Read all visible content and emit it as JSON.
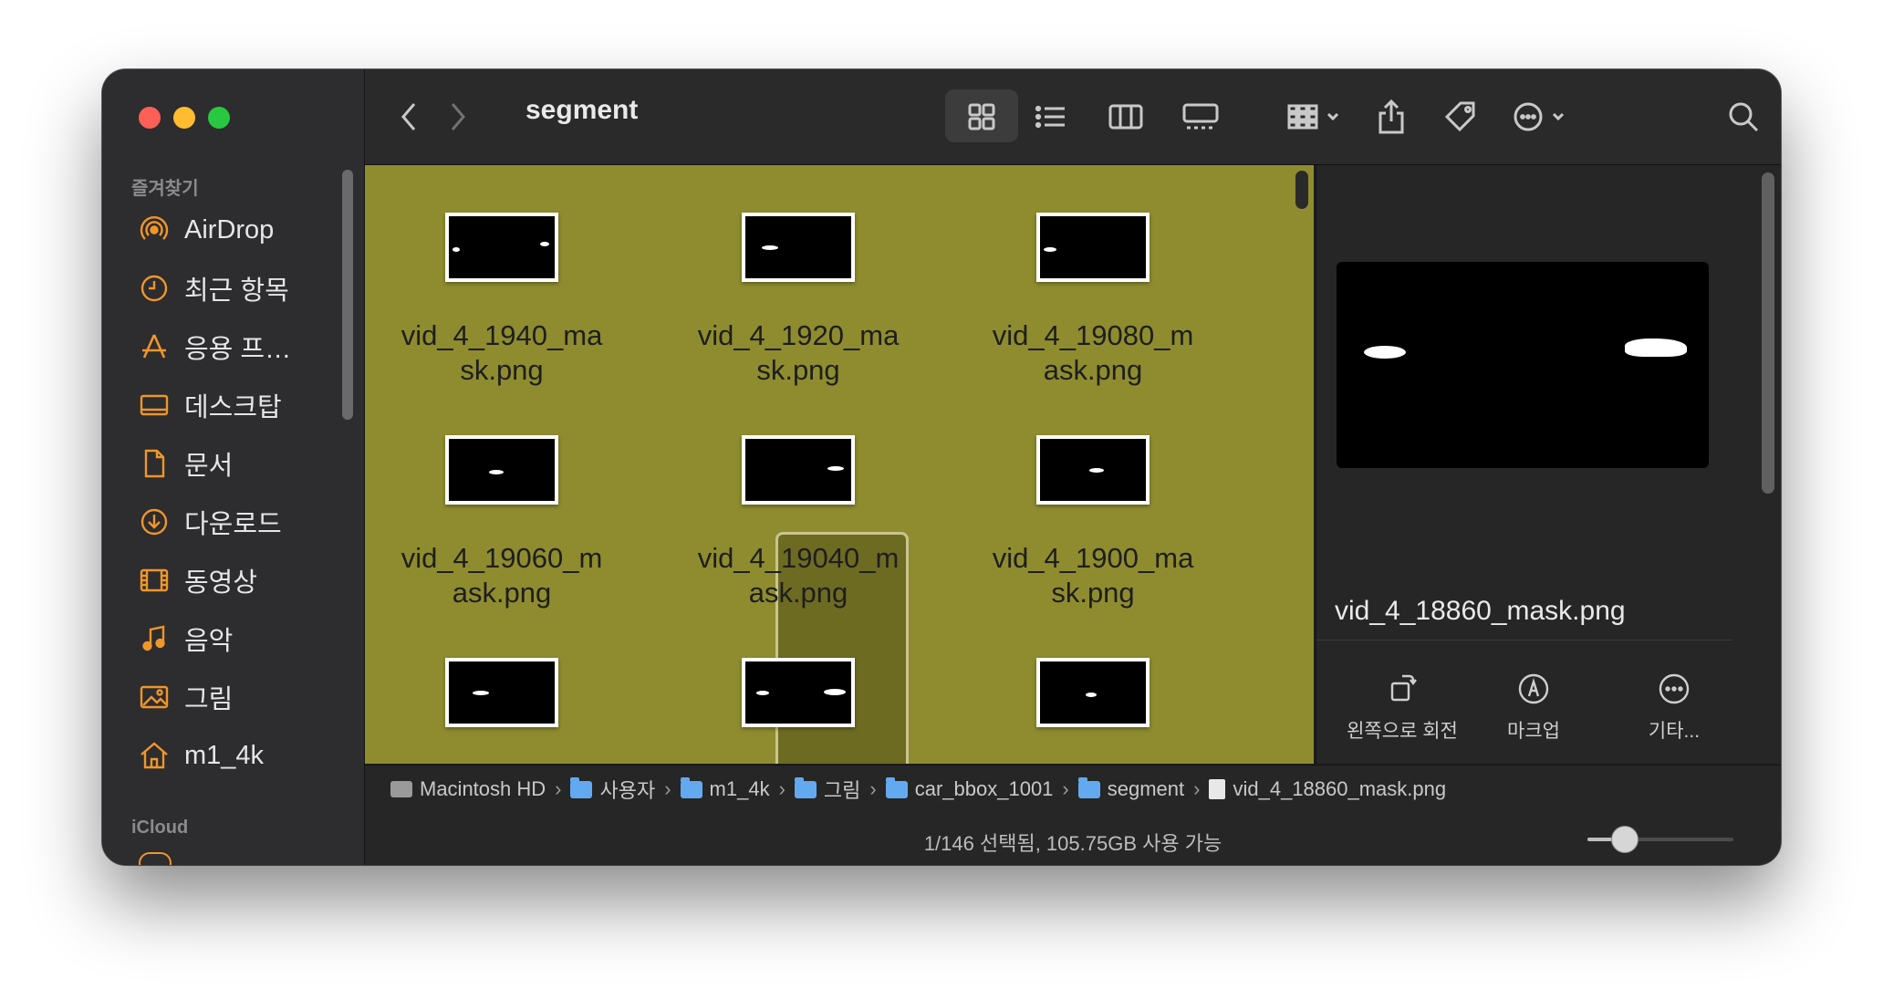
{
  "window": {
    "title": "segment"
  },
  "sidebar": {
    "favorites_label": "즐겨찾기",
    "items": [
      {
        "label": "AirDrop",
        "icon": "airdrop-icon"
      },
      {
        "label": "최근 항목",
        "icon": "clock-icon"
      },
      {
        "label": "응용 프…",
        "icon": "applications-icon"
      },
      {
        "label": "데스크탑",
        "icon": "desktop-icon"
      },
      {
        "label": "문서",
        "icon": "document-icon"
      },
      {
        "label": "다운로드",
        "icon": "download-icon"
      },
      {
        "label": "동영상",
        "icon": "movie-icon"
      },
      {
        "label": "음악",
        "icon": "music-icon"
      },
      {
        "label": "그림",
        "icon": "picture-icon"
      },
      {
        "label": "m1_4k",
        "icon": "home-icon"
      }
    ],
    "icloud_label": "iCloud",
    "accent_color": "#f0962a"
  },
  "files": [
    {
      "name": "vid_4_1940_mask.png"
    },
    {
      "name": "vid_4_1920_mask.png"
    },
    {
      "name": "vid_4_19080_mask.png"
    },
    {
      "name": "vid_4_19060_mask.png"
    },
    {
      "name": "vid_4_19040_mask.png"
    },
    {
      "name": "vid_4_1900_mask.png"
    },
    {
      "name": ""
    },
    {
      "name": ""
    },
    {
      "name": ""
    }
  ],
  "selected_file_index": 7,
  "preview": {
    "filename": "vid_4_18860_mask.png",
    "actions": [
      {
        "label": "왼쪽으로 회전",
        "icon": "rotate-left-icon"
      },
      {
        "label": "마크업",
        "icon": "markup-icon"
      },
      {
        "label": "기타...",
        "icon": "more-icon"
      }
    ]
  },
  "path": [
    {
      "label": "Macintosh HD",
      "icon": "disk-icon"
    },
    {
      "label": "사용자",
      "icon": "folder-icon"
    },
    {
      "label": "m1_4k",
      "icon": "home-folder-icon"
    },
    {
      "label": "그림",
      "icon": "folder-icon"
    },
    {
      "label": "car_bbox_1001",
      "icon": "folder-icon"
    },
    {
      "label": "segment",
      "icon": "folder-icon"
    },
    {
      "label": "vid_4_18860_mask.png",
      "icon": "file-icon"
    }
  ],
  "status": {
    "text": "1/146 선택됨, 105.75GB 사용 가능",
    "zoom_level": 0.25
  },
  "content_background": "#8e8c2f"
}
